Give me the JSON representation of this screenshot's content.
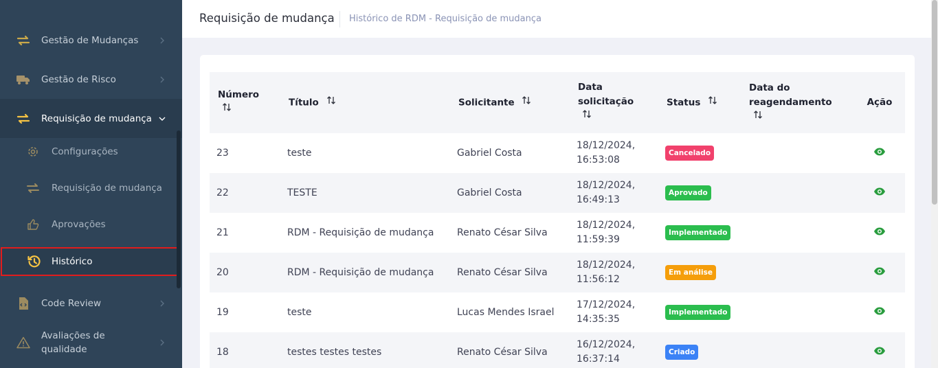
{
  "sidebar": {
    "items": [
      {
        "label": "Gestão de Mudanças",
        "icon": "arrows-exchange-icon"
      },
      {
        "label": "Gestão de Risco",
        "icon": "truck-icon"
      },
      {
        "label": "Requisição de mudança",
        "icon": "arrows-exchange-icon"
      },
      {
        "label": "Code Review",
        "icon": "code-file-icon"
      },
      {
        "label": "Avaliações de qualidade",
        "icon": "warning-triangle-icon"
      }
    ],
    "subitems": [
      {
        "label": "Configurações",
        "icon": "gear-icon"
      },
      {
        "label": "Requisição de mudança",
        "icon": "arrows-exchange-icon"
      },
      {
        "label": "Aprovações",
        "icon": "thumbs-up-icon"
      },
      {
        "label": "Histórico",
        "icon": "history-icon"
      }
    ],
    "colors": {
      "background": "#2f4458",
      "accent": "#f6c343",
      "selected_border": "#e31c1c"
    }
  },
  "header": {
    "title": "Requisição de mudança",
    "breadcrumb": "Histórico de RDM - Requisição de mudança"
  },
  "table": {
    "columns": [
      "Número",
      "Título",
      "Solicitante",
      "Data solicitação",
      "Status",
      "Data do reagendamento",
      "Ação"
    ],
    "rows": [
      {
        "numero": "23",
        "titulo": "teste",
        "solicitante": "Gabriel Costa",
        "data": "18/12/2024,",
        "hora": "16:53:08",
        "status": "Cancelado",
        "status_color": "#f1416c",
        "reagendamento": ""
      },
      {
        "numero": "22",
        "titulo": "TESTE",
        "solicitante": "Gabriel Costa",
        "data": "18/12/2024,",
        "hora": "16:49:13",
        "status": "Aprovado",
        "status_color": "#2bbd4e",
        "reagendamento": ""
      },
      {
        "numero": "21",
        "titulo": "RDM - Requisição de mudança",
        "solicitante": "Renato César Silva",
        "data": "18/12/2024,",
        "hora": "11:59:39",
        "status": "Implementado",
        "status_color": "#2bbd4e",
        "reagendamento": ""
      },
      {
        "numero": "20",
        "titulo": "RDM - Requisição de mudança",
        "solicitante": "Renato César Silva",
        "data": "18/12/2024,",
        "hora": "11:56:12",
        "status": "Em análise",
        "status_color": "#f59e0b",
        "reagendamento": ""
      },
      {
        "numero": "19",
        "titulo": "teste",
        "solicitante": "Lucas Mendes Israel",
        "data": "17/12/2024,",
        "hora": "14:35:35",
        "status": "Implementado",
        "status_color": "#2bbd4e",
        "reagendamento": ""
      },
      {
        "numero": "18",
        "titulo": "testes testes testes",
        "solicitante": "Renato César Silva",
        "data": "16/12/2024,",
        "hora": "16:37:14",
        "status": "Criado",
        "status_color": "#3b82f6",
        "reagendamento": ""
      }
    ],
    "action_icon": "eye-icon",
    "action_color": "#2a9d3f"
  }
}
